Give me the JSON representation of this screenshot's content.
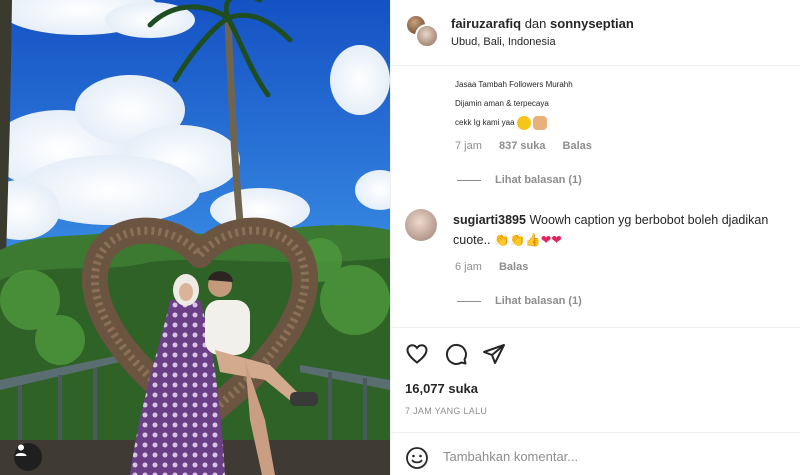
{
  "post": {
    "image_alt": "Couple sitting in heart-shaped nest swing in Bali"
  },
  "header": {
    "user1": "fairuzarafiq",
    "conjunction": "dan",
    "user2": "sonnyseptian",
    "location": "Ubud, Bali, Indonesia"
  },
  "comments": [
    {
      "lines": [
        "Jasaa Tambah Followers Murahh",
        "Dijamin aman & terpecaya",
        "cekk Ig kami yaa"
      ],
      "time": "7 jam",
      "likes": "837 suka",
      "reply_label": "Balas",
      "view_replies": "Lihat balasan (1)"
    },
    {
      "username": "sugiarti3895",
      "text": "Woowh caption yg berbobot boleh djadikan cuote..",
      "time": "6 jam",
      "reply_label": "Balas",
      "view_replies": "Lihat balasan (1)"
    }
  ],
  "actions": {
    "like_count": "16,077 suka",
    "time_ago": "7 JAM YANG LALU"
  },
  "comment_box": {
    "placeholder": "Tambahkan komentar..."
  },
  "icons": [
    "heart-icon",
    "comment-icon",
    "share-icon",
    "emoji-icon",
    "user-tag-icon"
  ]
}
